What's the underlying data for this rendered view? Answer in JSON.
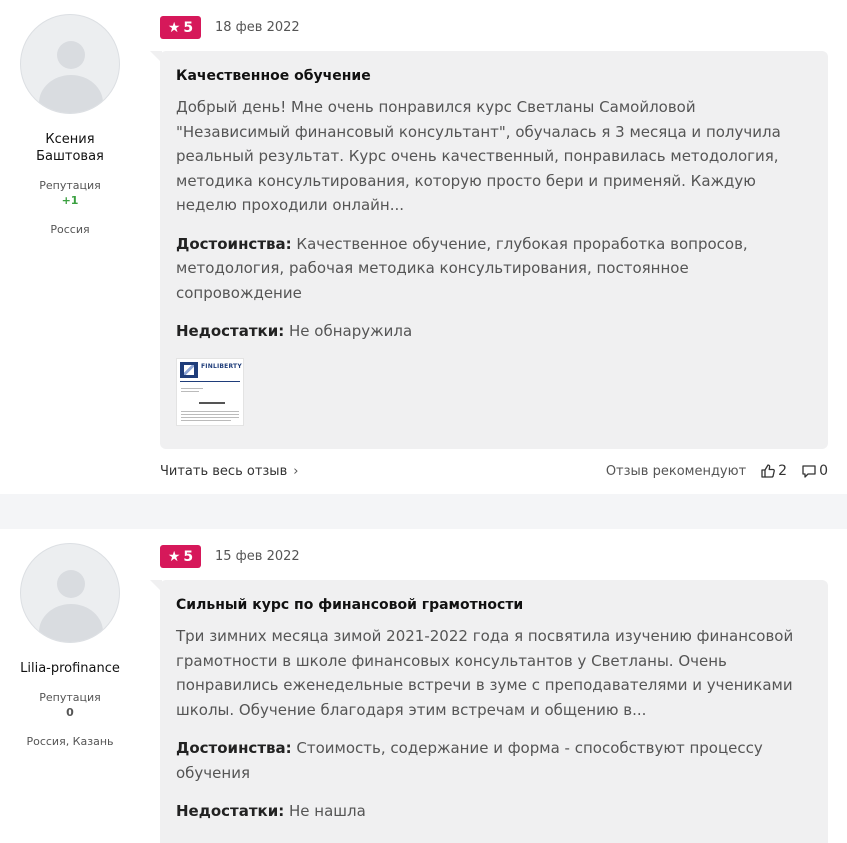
{
  "reviews": [
    {
      "author": {
        "name": "Ксения Баштовая",
        "reputation_label": "Репутация",
        "reputation_value": "+1",
        "location": "Россия"
      },
      "rating": "5",
      "date": "18 фев 2022",
      "title": "Качественное обучение",
      "text": "Добрый день! Мне очень понравился курс Светланы Самойловой \"Независимый финансовый консультант\", обучалась я 3 месяца и получила реальный результат. Курс очень качественный, понравилась методология, методика консультирования, которую просто бери и применяй. Каждую неделю проходили онлайн...",
      "pros_label": "Достоинства:",
      "pros": "Качественное обучение, глубокая проработка вопросов, методология, рабочая методика консультирования, постоянное сопровождение",
      "cons_label": "Недостатки:",
      "cons": "Не обнаружила",
      "attachment": {
        "logo_text": "FINLIBERTY",
        "icon": "document-thumbnail"
      },
      "read_more": "Читать весь отзыв",
      "recommend_label": "Отзыв рекомендуют",
      "likes": "2",
      "comments": "0"
    },
    {
      "author": {
        "name": "Lilia-profinance",
        "reputation_label": "Репутация",
        "reputation_value": "0",
        "location": "Россия, Казань"
      },
      "rating": "5",
      "date": "15 фев 2022",
      "title": "Сильный курс по финансовой грамотности",
      "text": "Три зимних месяца зимой 2021-2022 года я посвятила изучению финансовой грамотности в школе финансовых консультантов у Светланы. Очень понравились еженедельные встречи в зуме с преподавателями и учениками школы. Обучение благодаря этим встречам и общению в...",
      "pros_label": "Достоинства:",
      "pros": "Стоимость, содержание и форма - способствуют процессу обучения",
      "cons_label": "Недостатки:",
      "cons": "Не нашла"
    }
  ],
  "colors": {
    "badge": "#d6185a",
    "bubble": "#f0f0f1",
    "positive": "#3aa040"
  },
  "icons": {
    "rating": "star-icon",
    "like": "thumbs-up-icon",
    "comment": "comment-icon",
    "read_more": "chevron-right-icon"
  }
}
